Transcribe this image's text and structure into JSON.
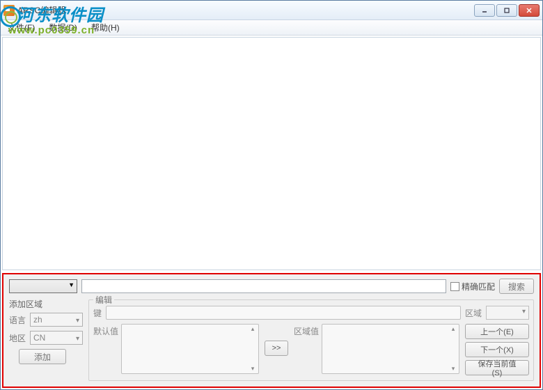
{
  "watermark": {
    "text": "河东软件园",
    "url": "www.pc0359.cn"
  },
  "window": {
    "title": "ARSC编辑器"
  },
  "menubar": {
    "file": "文件(F)",
    "data": "数据(D)",
    "help": "帮助(H)"
  },
  "search": {
    "exact_match": "精确匹配",
    "search_btn": "搜索"
  },
  "add_region": {
    "title": "添加区域",
    "language_label": "语言",
    "language_value": "zh",
    "region_label": "地区",
    "region_value": "CN",
    "add_btn": "添加"
  },
  "edit": {
    "title": "编辑",
    "key_label": "键",
    "region_label": "区域",
    "default_value_label": "默认值",
    "region_value_label": "区域值",
    "arrow_btn": ">>",
    "prev_btn": "上一个(E)",
    "next_btn": "下一个(X)",
    "save_btn": "保存当前值(S)"
  }
}
